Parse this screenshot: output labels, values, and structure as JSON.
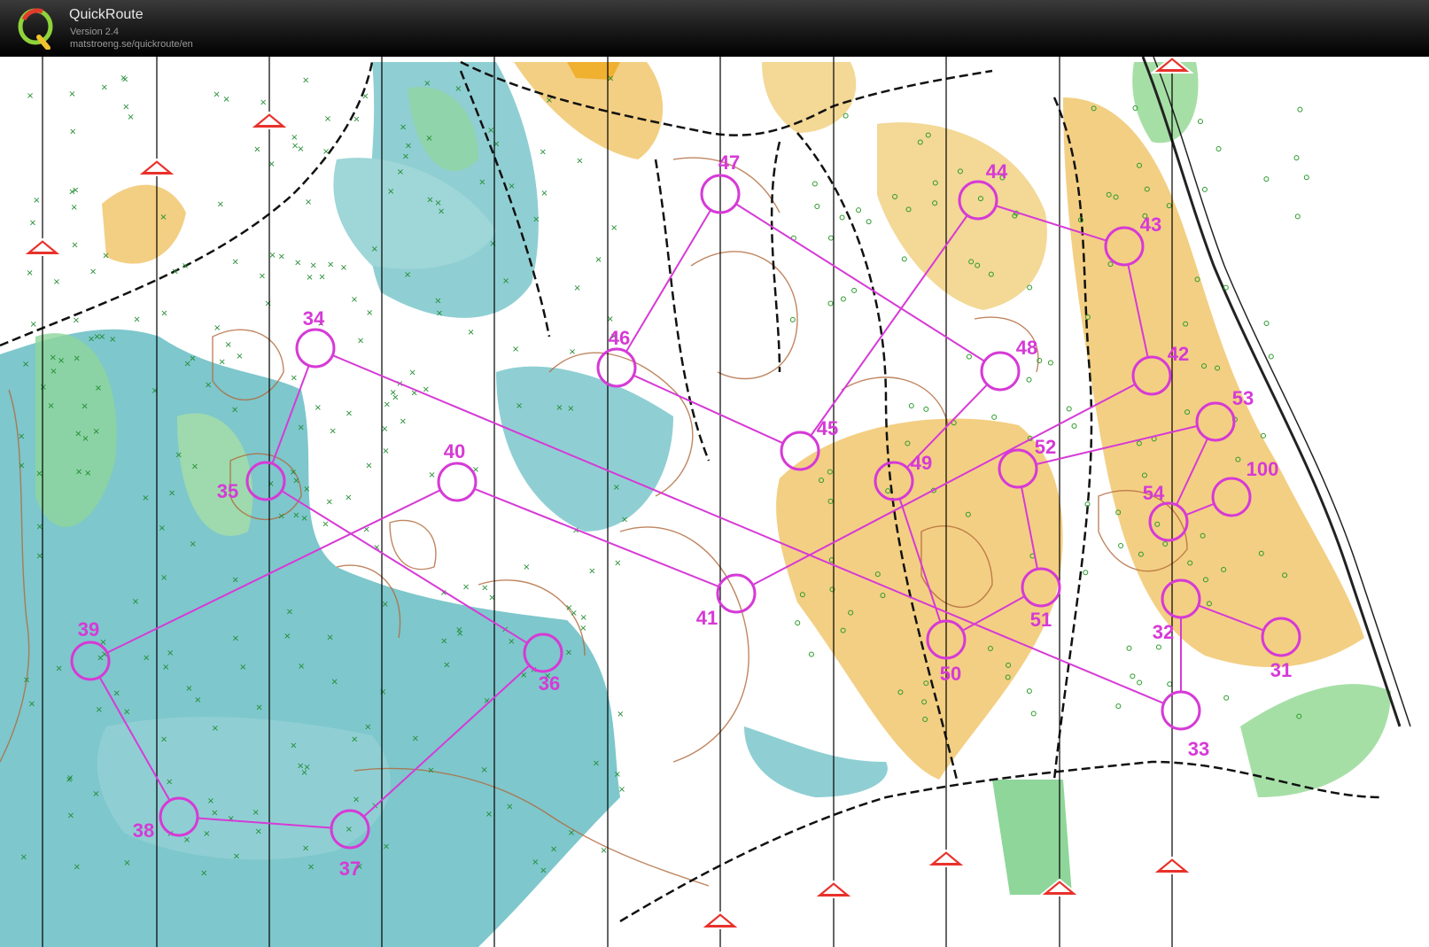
{
  "app": {
    "title": "QuickRoute",
    "version": "Version 2.4",
    "url": "matstroeng.se/quickroute/en"
  },
  "colors": {
    "course": "#d63ad6",
    "water_marsh": "#6fc2c8",
    "forest_green": "#9ad99a",
    "open_yellow": "#f2c66b",
    "contour_brown": "#b0683a",
    "north_lines": "#000000"
  },
  "icons": [
    "quickroute-logo-icon",
    "north-arrow-icon"
  ],
  "course": {
    "controls": [
      {
        "label": "31"
      },
      {
        "label": "32"
      },
      {
        "label": "33"
      },
      {
        "label": "34"
      },
      {
        "label": "35"
      },
      {
        "label": "36"
      },
      {
        "label": "37"
      },
      {
        "label": "38"
      },
      {
        "label": "39"
      },
      {
        "label": "40"
      },
      {
        "label": "41"
      },
      {
        "label": "42"
      },
      {
        "label": "43"
      },
      {
        "label": "44"
      },
      {
        "label": "45"
      },
      {
        "label": "46"
      },
      {
        "label": "47"
      },
      {
        "label": "48"
      },
      {
        "label": "49"
      },
      {
        "label": "50"
      },
      {
        "label": "51"
      },
      {
        "label": "52"
      },
      {
        "label": "53"
      },
      {
        "label": "54"
      },
      {
        "label": "100"
      }
    ],
    "legs": [
      [
        "31",
        "32"
      ],
      [
        "32",
        "33"
      ],
      [
        "33",
        "34"
      ],
      [
        "34",
        "35"
      ],
      [
        "35",
        "36"
      ],
      [
        "36",
        "37"
      ],
      [
        "37",
        "38"
      ],
      [
        "38",
        "39"
      ],
      [
        "39",
        "40"
      ],
      [
        "40",
        "41"
      ],
      [
        "41",
        "42"
      ],
      [
        "42",
        "43"
      ],
      [
        "43",
        "44"
      ],
      [
        "44",
        "45"
      ],
      [
        "45",
        "46"
      ],
      [
        "46",
        "47"
      ],
      [
        "47",
        "48"
      ],
      [
        "48",
        "49"
      ],
      [
        "49",
        "50"
      ],
      [
        "50",
        "51"
      ],
      [
        "51",
        "52"
      ],
      [
        "52",
        "53"
      ],
      [
        "53",
        "54"
      ],
      [
        "54",
        "100"
      ]
    ]
  }
}
